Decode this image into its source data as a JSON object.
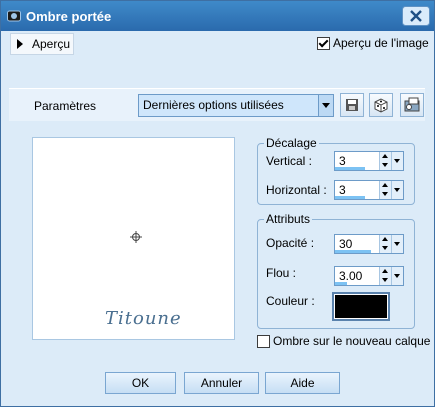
{
  "window": {
    "title": "Ombre portée"
  },
  "preview_toggle": {
    "label": "Aperçu"
  },
  "image_preview": {
    "label": "Aperçu de l'image",
    "checked": true
  },
  "params": {
    "label": "Paramètres",
    "preset_value": "Dernières options utilisées"
  },
  "decalage": {
    "title": "Décalage",
    "vertical_label": "Vertical :",
    "vertical_value": "3",
    "horizontal_label": "Horizontal :",
    "horizontal_value": "3"
  },
  "attributs": {
    "title": "Attributs",
    "opacity_label": "Opacité :",
    "opacity_value": "30",
    "blur_label": "Flou :",
    "blur_value": "3.00",
    "color_label": "Couleur :",
    "color_hex": "#000000"
  },
  "new_layer": {
    "label": "Ombre sur le nouveau calque",
    "checked": false
  },
  "preview": {
    "logo_text": "Titoune"
  },
  "buttons": {
    "ok": "OK",
    "cancel": "Annuler",
    "help": "Aide"
  },
  "colors": {
    "titlebar": "#2f77b9",
    "dialog_bg": "#dcebf8",
    "accent": "#7cc2f3"
  }
}
